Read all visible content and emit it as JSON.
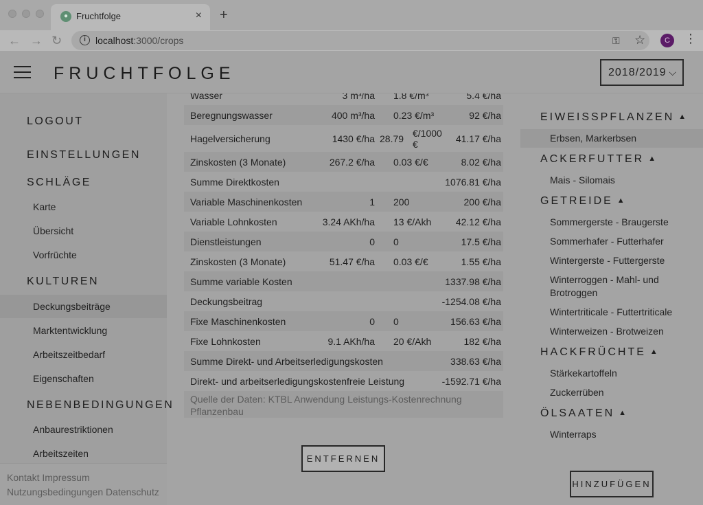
{
  "browser": {
    "tab_title": "Fruchtfolge",
    "url_host": "localhost",
    "url_path": ":3000/crops",
    "profile_initial": "C"
  },
  "header": {
    "title": "FRUCHTFOLGE",
    "year": "2018/2019"
  },
  "sidebar": {
    "logout": "LOGOUT",
    "settings": "EINSTELLUNGEN",
    "plots": "SCHLÄGE",
    "plots_items": [
      "Karte",
      "Übersicht",
      "Vorfrüchte"
    ],
    "crops": "KULTUREN",
    "crops_items": [
      "Deckungsbeiträge",
      "Marktentwicklung",
      "Arbeitszeitbedarf",
      "Eigenschaften"
    ],
    "constraints": "NEBENBEDINGUNGEN",
    "constraints_items": [
      "Anbaurestriktionen",
      "Arbeitszeiten"
    ],
    "footer": {
      "contact": "Kontakt",
      "imprint": "Impressum",
      "terms": "Nutzungsbedingungen",
      "privacy": "Datenschutz"
    }
  },
  "table": {
    "rows": [
      {
        "label": "Wasser",
        "qty": "3 m³/ha",
        "price": "1.8 €/m³",
        "total": "5.4 €/ha"
      },
      {
        "label": "Beregnungswasser",
        "qty": "400 m³/ha",
        "price": "0.23 €/m³",
        "total": "92 €/ha"
      },
      {
        "label": "Hagelversicherung",
        "qty": "1430 €/ha",
        "price_num": "28.79",
        "price_unit": "€/1000 €",
        "total": "41.17 €/ha"
      },
      {
        "label": "Zinskosten (3 Monate)",
        "qty": "267.2 €/ha",
        "price": "0.03 €/€",
        "total": "8.02 €/ha"
      },
      {
        "label": "Summe Direktkosten",
        "qty": "",
        "price": "",
        "total": "1076.81 €/ha"
      },
      {
        "label": "Variable Maschinenkosten",
        "qty": "1",
        "price": "200",
        "total": "200 €/ha"
      },
      {
        "label": "Variable Lohnkosten",
        "qty": "3.24 AKh/ha",
        "price": "13 €/Akh",
        "total": "42.12 €/ha"
      },
      {
        "label": "Dienstleistungen",
        "qty": "0",
        "price": "0",
        "total": "17.5 €/ha"
      },
      {
        "label": "Zinskosten (3 Monate)",
        "qty": "51.47 €/ha",
        "price": "0.03 €/€",
        "total": "1.55 €/ha"
      },
      {
        "label": "Summe variable Kosten",
        "qty": "",
        "price": "",
        "total": "1337.98 €/ha"
      },
      {
        "label": "Deckungsbeitrag",
        "qty": "",
        "price": "",
        "total": "-1254.08 €/ha"
      },
      {
        "label": "Fixe Maschinenkosten",
        "qty": "0",
        "price": "0",
        "total": "156.63 €/ha"
      },
      {
        "label": "Fixe Lohnkosten",
        "qty": "9.1 AKh/ha",
        "price": "20 €/Akh",
        "total": "182 €/ha"
      },
      {
        "label": "Summe Direkt- und Arbeitserledigungskosten",
        "qty": "",
        "price": "",
        "total": "338.63 €/ha"
      },
      {
        "label": "Direkt- und arbeitserledigungskostenfreie Leistung",
        "qty": "",
        "price": "",
        "total": "-1592.71 €/ha"
      }
    ],
    "source": "Quelle der Daten: KTBL Anwendung Leistungs-Kostenrechnung Pflanzenbau",
    "remove_label": "ENTFERNEN"
  },
  "crops_panel": {
    "categories": [
      {
        "name": "EIWEISSPFLANZEN",
        "items": [
          "Erbsen, Markerbsen"
        ]
      },
      {
        "name": "ACKERFUTTER",
        "items": [
          "Mais - Silomais"
        ]
      },
      {
        "name": "GETREIDE",
        "items": [
          "Sommergerste - Braugerste",
          "Sommerhafer - Futterhafer",
          "Wintergerste - Futtergerste",
          "Winterroggen - Mahl- und Brotroggen",
          "Wintertriticale - Futtertriticale",
          "Winterweizen - Brotweizen"
        ]
      },
      {
        "name": "HACKFRÜCHTE",
        "items": [
          "Stärkekartoffeln",
          "Zuckerrüben"
        ]
      },
      {
        "name": "ÖLSAATEN",
        "items": [
          "Winterraps"
        ]
      }
    ],
    "add_label": "HINZUFÜGEN"
  }
}
